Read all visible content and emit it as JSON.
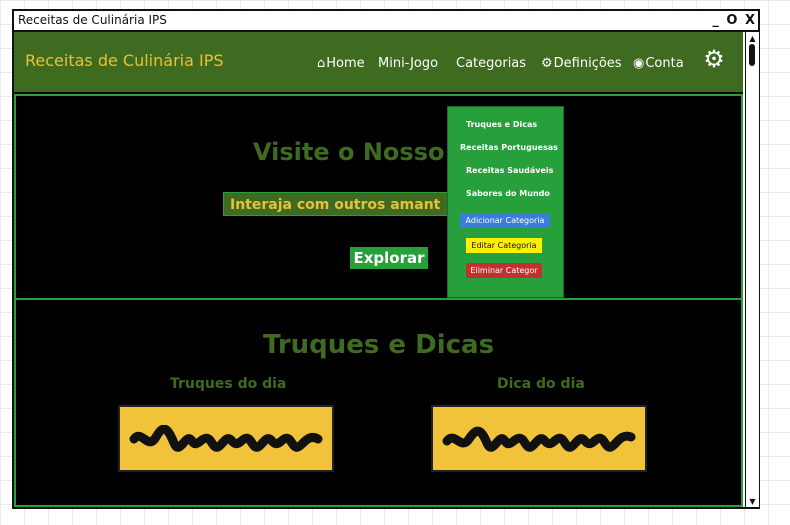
{
  "window": {
    "title": "Receitas de Culinária IPS",
    "controls": [
      "_",
      "O",
      "X"
    ]
  },
  "navbar": {
    "brand": "Receitas de Culinária IPS",
    "items": [
      {
        "label": "Home",
        "icon": "home-icon"
      },
      {
        "label": "Mini-Jogo"
      },
      {
        "label": "Categorias"
      },
      {
        "label": "Definições",
        "icon": "gear-icon"
      },
      {
        "label": "Conta",
        "icon": "user-icon"
      }
    ],
    "settings_icon": "gear-icon"
  },
  "hero": {
    "title": "Visite o Nosso",
    "input_text": "Interaja com outros amant",
    "button": "Explorar"
  },
  "tips": {
    "title": "Truques e Dicas",
    "cards": [
      {
        "label": "Truques do dia"
      },
      {
        "label": "Dica do dia"
      }
    ]
  },
  "dropdown": {
    "items": [
      "Truques e Dicas",
      "Receitas Portuguesas",
      "Receitas Saudáveis",
      "Sabores do Mundo"
    ],
    "add_button": "Adicionar Categoria",
    "edit_button": "Editar Categoria",
    "delete_button": "Eliminar Categor"
  },
  "colors": {
    "navbar": "#3e6b1f",
    "accent_green": "#27a03b",
    "brand_yellow": "#e8c13a",
    "card_yellow": "#f0c33a"
  }
}
